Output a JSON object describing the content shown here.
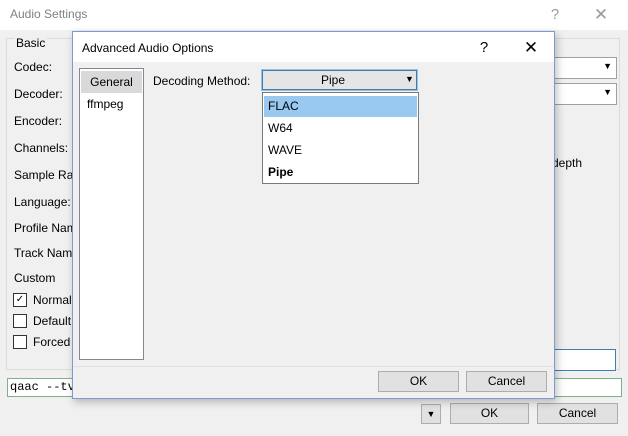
{
  "background_dialog": {
    "title": "Audio Settings",
    "help_glyph": "?",
    "close_glyph": "✕",
    "group_label": "Basic",
    "labels": {
      "codec": "Codec:",
      "decoder": "Decoder:",
      "encoder": "Encoder:",
      "channels": "Channels:",
      "sample_rate": "Sample Rat",
      "language": "Language:",
      "profile_name": "Profile Nam",
      "track_name": "Track Nam",
      "custom": "Custom"
    },
    "checkboxes": [
      {
        "label": "Normal",
        "checked": true
      },
      {
        "label": "Default",
        "checked": false
      },
      {
        "label": "Forced",
        "checked": false
      }
    ],
    "bit_depth_label": "depth",
    "command_line": "qaac --tv",
    "buttons": {
      "menu_arrow": "▼",
      "ok": "OK",
      "cancel": "Cancel"
    }
  },
  "dialog": {
    "title": "Advanced Audio Options",
    "help_glyph": "?",
    "close_glyph": "✕",
    "nav_items": [
      {
        "label": "General",
        "selected": true
      },
      {
        "label": "ffmpeg",
        "selected": false
      }
    ],
    "decoding_method": {
      "label": "Decoding Method:",
      "value": "Pipe",
      "arrow": "▼",
      "options": [
        {
          "label": "FLAC",
          "highlighted": true,
          "bold": false
        },
        {
          "label": "W64",
          "highlighted": false,
          "bold": false
        },
        {
          "label": "WAVE",
          "highlighted": false,
          "bold": false
        },
        {
          "label": "Pipe",
          "highlighted": false,
          "bold": true
        }
      ]
    },
    "buttons": {
      "ok": "OK",
      "cancel": "Cancel"
    }
  },
  "colors": {
    "highlight": "#99c9f0",
    "focus_border": "#3c7fb1",
    "dialog_bg": "#f0f0f0"
  }
}
